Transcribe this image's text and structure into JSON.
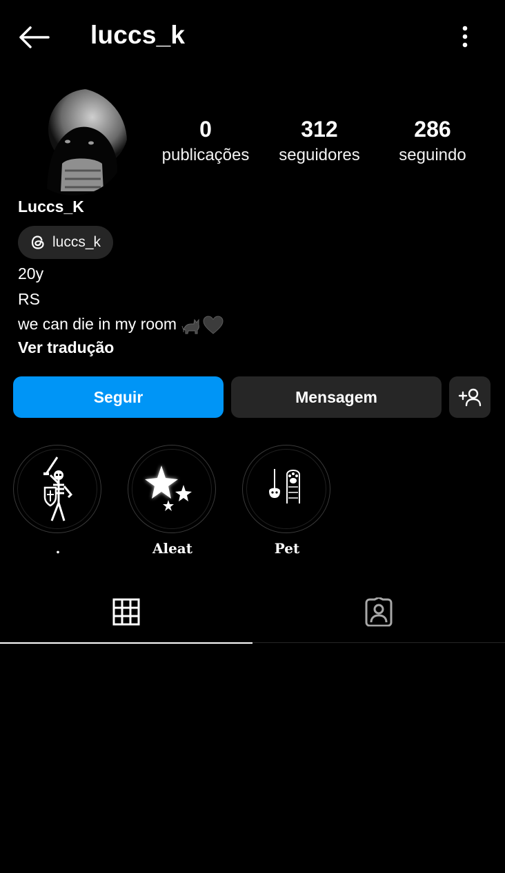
{
  "header": {
    "username": "luccs_k",
    "back_icon": "arrow-left-icon",
    "menu_icon": "more-vertical-icon"
  },
  "stats": {
    "posts": {
      "count": "0",
      "label": "publicações"
    },
    "followers": {
      "count": "312",
      "label": "seguidores"
    },
    "following": {
      "count": "286",
      "label": "seguindo"
    }
  },
  "profile": {
    "display_name": "Luccs_K",
    "threads_handle": "luccs_k",
    "bio": [
      "20y",
      "RS",
      "we can die in my room"
    ],
    "translate_link": "Ver tradução"
  },
  "actions": {
    "follow": "Seguir",
    "message": "Mensagem",
    "suggest_icon": "add-person-icon"
  },
  "highlights": [
    {
      "title": "."
    },
    {
      "title": "Aleat"
    },
    {
      "title": "Pet"
    }
  ],
  "tabs": [
    {
      "name": "posts",
      "icon": "grid-icon",
      "active": true
    },
    {
      "name": "tagged",
      "icon": "tagged-person-icon",
      "active": false
    }
  ],
  "colors": {
    "background": "#000000",
    "accent": "#0095f6",
    "secondary_button": "#262626"
  }
}
